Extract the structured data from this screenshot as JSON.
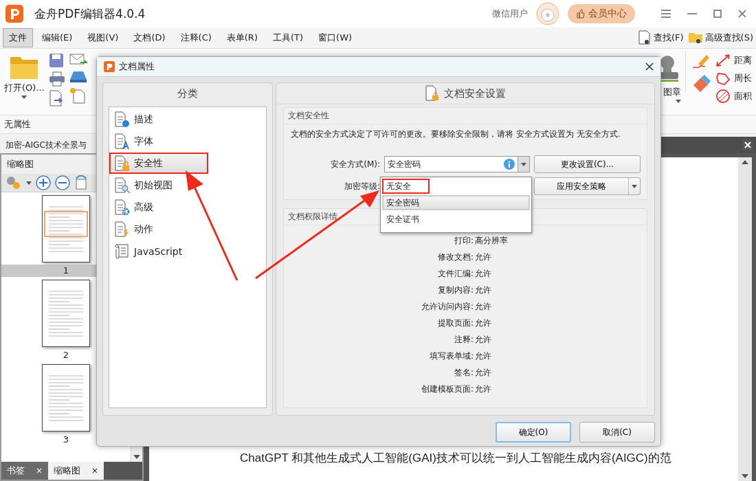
{
  "app": {
    "title": "金舟PDF编辑器4.0.4",
    "user": "微信用户",
    "vip_button": "会员中心"
  },
  "menu": [
    {
      "label": "文件",
      "selected": true
    },
    {
      "label": "编辑(E)",
      "selected": false
    },
    {
      "label": "视图(V)",
      "selected": false
    },
    {
      "label": "文档(D)",
      "selected": false
    },
    {
      "label": "注释(C)",
      "selected": false
    },
    {
      "label": "表单(R)",
      "selected": false
    },
    {
      "label": "工具(T)",
      "selected": false
    },
    {
      "label": "窗口(W)",
      "selected": false
    }
  ],
  "search": [
    {
      "label": "查找(F)"
    },
    {
      "label": "高级查找(S)"
    }
  ],
  "toolbar": {
    "open": "打开(O)...",
    "stamp": "图章",
    "measure": [
      "距离",
      "周长",
      "面积"
    ]
  },
  "properties_bar": "无属性",
  "document_tab": "加密-AIGC技术全景与",
  "thumbnails": {
    "title": "缩略图",
    "pages": [
      {
        "label": "1",
        "selected": true
      },
      {
        "label": "2",
        "selected": false
      },
      {
        "label": "3",
        "selected": false
      }
    ]
  },
  "panel_tabs": [
    {
      "label": "书签",
      "selected": false,
      "close": "×"
    },
    {
      "label": "缩略图",
      "selected": true,
      "close": "×"
    }
  ],
  "document_text": "ChatGPT 和其他生成式人工智能(GAI)技术可以统一到人工智能生成内容(AIGC)的范",
  "dialog": {
    "title": "文档属性",
    "category_header": "分类",
    "categories": [
      {
        "label": "描述",
        "kind": "info",
        "selected": false,
        "highlighted": false
      },
      {
        "label": "字体",
        "kind": "font",
        "selected": false,
        "highlighted": false
      },
      {
        "label": "安全性",
        "kind": "lock",
        "selected": true,
        "highlighted": true
      },
      {
        "label": "初始视图",
        "kind": "view",
        "selected": false,
        "highlighted": false
      },
      {
        "label": "高级",
        "kind": "gear",
        "selected": false,
        "highlighted": false
      },
      {
        "label": "动作",
        "kind": "action",
        "selected": false,
        "highlighted": false
      },
      {
        "label": "JavaScript",
        "kind": "script",
        "selected": false,
        "highlighted": false
      }
    ],
    "settings_header": "文档安全设置",
    "security_group": "文档安全性",
    "description": "文档的安全方式决定了可许可的更改。要移除安全限制，请将 安全方式设置为 无安全方式.",
    "method_label": "安全方式(M):",
    "method_value": "安全密码",
    "encryption_label": "加密等级:",
    "change_button": "更改设置(C)...",
    "policy_button": "应用安全策略",
    "dropdown": [
      {
        "label": "无安全",
        "selected": false,
        "highlighted": true
      },
      {
        "label": "安全密码",
        "selected": true,
        "highlighted": false
      },
      {
        "label": "安全证书",
        "selected": false,
        "highlighted": false
      }
    ],
    "permissions_group": "文档权限详情",
    "permissions": [
      {
        "name": "打印:",
        "value": "高分辨率"
      },
      {
        "name": "修改文档:",
        "value": "允许"
      },
      {
        "name": "文件汇编:",
        "value": "允许"
      },
      {
        "name": "复制内容:",
        "value": "允许"
      },
      {
        "name": "允许访问内容:",
        "value": "允许"
      },
      {
        "name": "提取页面:",
        "value": "允许"
      },
      {
        "name": "注释:",
        "value": "允许"
      },
      {
        "name": "填写表单域:",
        "value": "允许"
      },
      {
        "name": "签名:",
        "value": "允许"
      },
      {
        "name": "创建模板页面:",
        "value": "允许"
      }
    ],
    "ok_button": "确定(O)",
    "cancel_button": "取消(C)"
  }
}
